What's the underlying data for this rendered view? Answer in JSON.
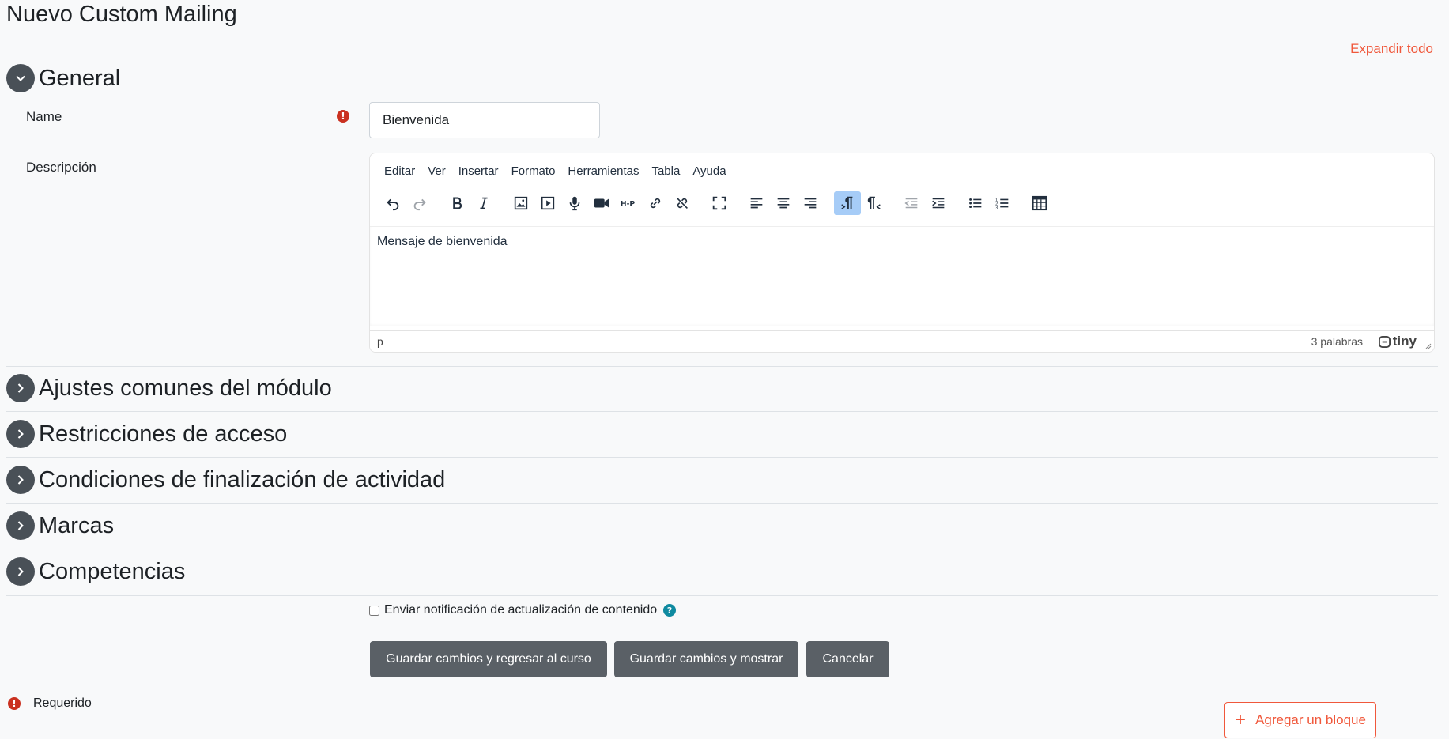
{
  "page": {
    "title": "Nuevo Custom Mailing",
    "expand_all": "Expandir todo"
  },
  "sections": {
    "general": "General",
    "common": "Ajustes comunes del módulo",
    "access": "Restricciones de acceso",
    "completion": "Condiciones de finalización de actividad",
    "tags": "Marcas",
    "competencies": "Competencias"
  },
  "form": {
    "name_label": "Name",
    "name_value": "Bienvenida",
    "description_label": "Descripción"
  },
  "editor": {
    "menu": [
      "Editar",
      "Ver",
      "Insertar",
      "Formato",
      "Herramientas",
      "Tabla",
      "Ayuda"
    ],
    "content": "Mensaje de bienvenida",
    "status_path": "p",
    "word_count": "3 palabras",
    "brand": "tiny"
  },
  "notify": {
    "label": "Enviar notificación de actualización de contenido"
  },
  "buttons": {
    "save_return": "Guardar cambios y regresar al curso",
    "save_show": "Guardar cambios y mostrar",
    "cancel": "Cancelar"
  },
  "required_text": "Requerido",
  "add_block": "Agregar un bloque",
  "icons": {
    "required": "!",
    "help": "?",
    "plus": "+"
  },
  "colors": {
    "accent": "#f0583b",
    "button_bg": "#5a6066",
    "required": "#ca3120",
    "help": "#0f8aa0"
  }
}
